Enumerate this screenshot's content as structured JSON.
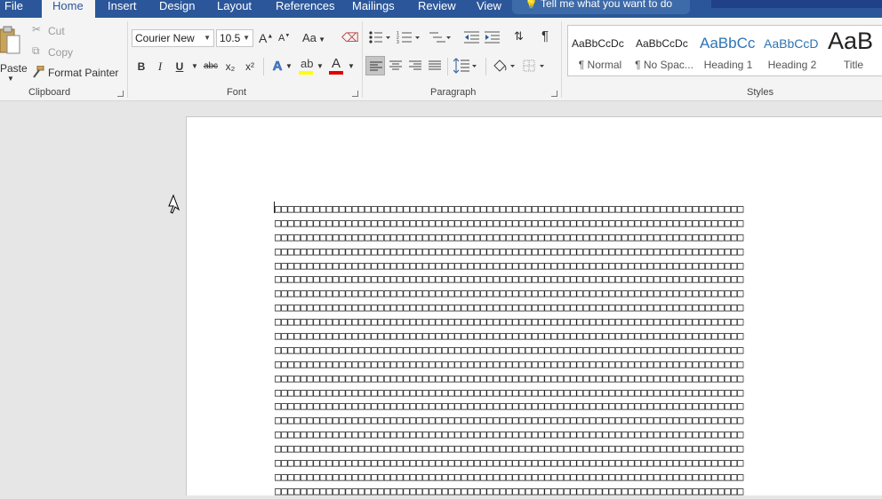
{
  "tabs": [
    {
      "label": "File",
      "active": false
    },
    {
      "label": "Home",
      "active": true
    },
    {
      "label": "Insert",
      "active": false
    },
    {
      "label": "Design",
      "active": false
    },
    {
      "label": "Layout",
      "active": false
    },
    {
      "label": "References",
      "active": false
    },
    {
      "label": "Mailings",
      "active": false
    },
    {
      "label": "Review",
      "active": false
    },
    {
      "label": "View",
      "active": false
    }
  ],
  "tell_me": "Tell me what you want to do",
  "clipboard": {
    "paste": "Paste",
    "cut": "Cut",
    "copy": "Copy",
    "format_painter": "Format Painter",
    "label": "Clipboard"
  },
  "font": {
    "family": "Courier New",
    "size": "10.5",
    "label": "Font",
    "change_case": "Aa",
    "bold": "B",
    "italic": "I",
    "underline": "U",
    "strike": "abc",
    "subscript": "x₂",
    "superscript": "x²",
    "text_effects": "A",
    "font_color": "A",
    "grow": "A",
    "shrink": "A"
  },
  "paragraph": {
    "label": "Paragraph",
    "pilcrow": "¶"
  },
  "styles": {
    "label": "Styles",
    "items": [
      {
        "preview": "AaBbCcDc",
        "name": "¶ Normal"
      },
      {
        "preview": "AaBbCcDc",
        "name": "¶ No Spac..."
      },
      {
        "preview": "AaBbCc",
        "name": "Heading 1"
      },
      {
        "preview": "AaBbCcD",
        "name": "Heading 2"
      },
      {
        "preview": "AaB",
        "name": "Title"
      }
    ]
  },
  "document": {
    "glyph": "□",
    "cols": 73,
    "rows": 21
  },
  "colors": {
    "ribbon_blue": "#2b579a",
    "highlight_yellow": "#ffff00",
    "font_red": "#e00000",
    "heading_blue": "#2e74b5"
  }
}
